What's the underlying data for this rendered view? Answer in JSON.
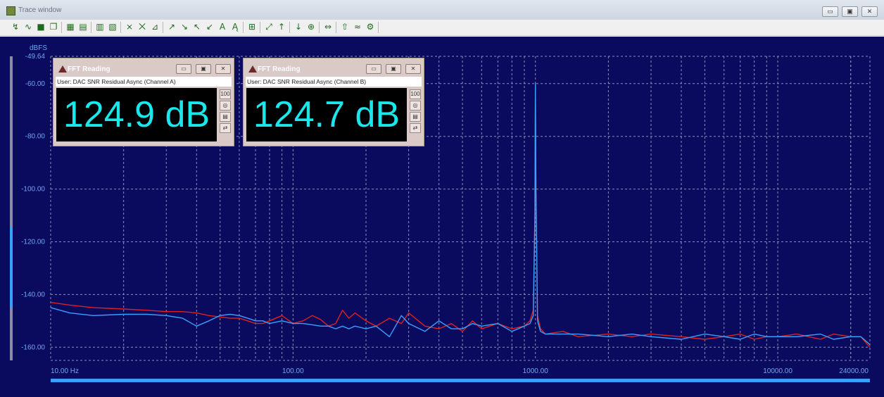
{
  "window": {
    "title": "Trace window",
    "minimize_glyph": "▭",
    "restore_glyph": "▣",
    "close_glyph": "✕"
  },
  "toolbar": {
    "icons": [
      "trace-add-icon",
      "trace-wave-icon",
      "save-icon",
      "copy-icon",
      "graph-settings-icon",
      "graph-export-icon",
      "edit-grid-icon",
      "data-table-icon",
      "cursor-x-icon",
      "cursor-y-icon",
      "zoom-icon",
      "marker-1-icon",
      "marker-2-icon",
      "marker-3-icon",
      "marker-4-icon",
      "label-icon",
      "label-alt-icon",
      "scale-icon",
      "autoscale-icon",
      "trace-up-icon",
      "trace-down-icon",
      "meter-icon",
      "fit-icon",
      "undo-icon",
      "compare-icon",
      "config-icon"
    ]
  },
  "colors": {
    "background": "#0a0a5e",
    "grid": "#8d8dbf",
    "tick_label": "#6fa9f0",
    "channel_a": "#e02020",
    "channel_b": "#3aa0ff",
    "reading": "#19e7ec"
  },
  "chart_data": {
    "type": "line",
    "ylabel": "dBFS",
    "xscale": "log",
    "xlim": [
      10,
      24000
    ],
    "ylim": [
      -165,
      -49.64
    ],
    "x_ticks": [
      10,
      100,
      1000,
      10000,
      24000
    ],
    "x_tick_labels": [
      "10.00 Hz",
      "100.00",
      "1000.00",
      "10000.00",
      "24000.00"
    ],
    "y_ticks": [
      -49.64,
      -60,
      -80,
      -100,
      -120,
      -140,
      -160
    ],
    "y_tick_labels": [
      "-49.64",
      "-60.00",
      "-80.00",
      "-100.00",
      "-120.00",
      "-140.00",
      "-160.00"
    ],
    "grid": true,
    "series": [
      {
        "color": "#e02020",
        "x": [
          10,
          12,
          15,
          20,
          25,
          30,
          35,
          40,
          45,
          50,
          55,
          60,
          65,
          70,
          75,
          80,
          90,
          100,
          110,
          120,
          130,
          140,
          150,
          160,
          170,
          180,
          200,
          220,
          250,
          280,
          300,
          350,
          400,
          450,
          500,
          550,
          600,
          700,
          800,
          900,
          950,
          980,
          995,
          1000,
          1005,
          1020,
          1050,
          1100,
          1300,
          1500,
          2000,
          2500,
          3000,
          4000,
          5000,
          6000,
          7000,
          8000,
          9000,
          10000,
          12000,
          15000,
          17000,
          20000,
          22000,
          24000
        ],
        "y": [
          -143,
          -144,
          -145,
          -145.5,
          -146,
          -146.5,
          -146.5,
          -147,
          -148,
          -148.5,
          -149,
          -149,
          -150,
          -151,
          -151,
          -150,
          -148,
          -151,
          -150,
          -148,
          -149.5,
          -152,
          -151,
          -146,
          -149,
          -147,
          -150,
          -152,
          -149,
          -151,
          -147,
          -152,
          -153,
          -151,
          -154,
          -150,
          -153,
          -151,
          -153,
          -152,
          -150,
          -146,
          -110,
          -60,
          -100,
          -148,
          -153,
          -155,
          -154,
          -156,
          -155,
          -156,
          -155,
          -156,
          -157,
          -156,
          -155,
          -157,
          -156,
          -156,
          -155,
          -157,
          -155,
          -156,
          -156,
          -160
        ]
      },
      {
        "color": "#3aa0ff",
        "x": [
          10,
          12,
          15,
          20,
          25,
          30,
          35,
          40,
          45,
          50,
          55,
          60,
          65,
          70,
          75,
          80,
          90,
          100,
          110,
          120,
          130,
          140,
          150,
          160,
          170,
          180,
          200,
          220,
          250,
          280,
          300,
          350,
          400,
          450,
          500,
          550,
          600,
          700,
          800,
          900,
          950,
          980,
          995,
          1000,
          1005,
          1020,
          1050,
          1100,
          1300,
          1500,
          2000,
          2500,
          3000,
          4000,
          5000,
          6000,
          7000,
          8000,
          9000,
          10000,
          12000,
          15000,
          17000,
          20000,
          22000,
          24000
        ],
        "y": [
          -145,
          -147,
          -148,
          -147.5,
          -147.5,
          -148,
          -149,
          -152,
          -150,
          -148,
          -147.5,
          -148,
          -149,
          -150,
          -150,
          -151,
          -150,
          -151,
          -151,
          -151.5,
          -152,
          -152,
          -153,
          -152,
          -153,
          -152,
          -153,
          -152,
          -156,
          -148,
          -151,
          -154,
          -150,
          -153,
          -153,
          -151,
          -152,
          -151,
          -154,
          -152,
          -151,
          -148,
          -110,
          -60,
          -100,
          -150,
          -154,
          -155,
          -155,
          -155,
          -156,
          -155,
          -156,
          -157,
          -155,
          -156,
          -157,
          -155,
          -156,
          -156,
          -156,
          -155,
          -157,
          -156,
          -156,
          -159
        ]
      }
    ]
  },
  "readings": [
    {
      "title": "FFT Reading",
      "label": "User: DAC SNR Residual Async (Channel A)",
      "value": "124.9 dB",
      "side_buttons": [
        "100",
        "◎",
        "▤",
        "⇄"
      ]
    },
    {
      "title": "FFT Reading",
      "label": "User: DAC SNR Residual Async (Channel B)",
      "value": "124.7 dB",
      "side_buttons": [
        "100",
        "◎",
        "▤",
        "⇄"
      ]
    }
  ]
}
